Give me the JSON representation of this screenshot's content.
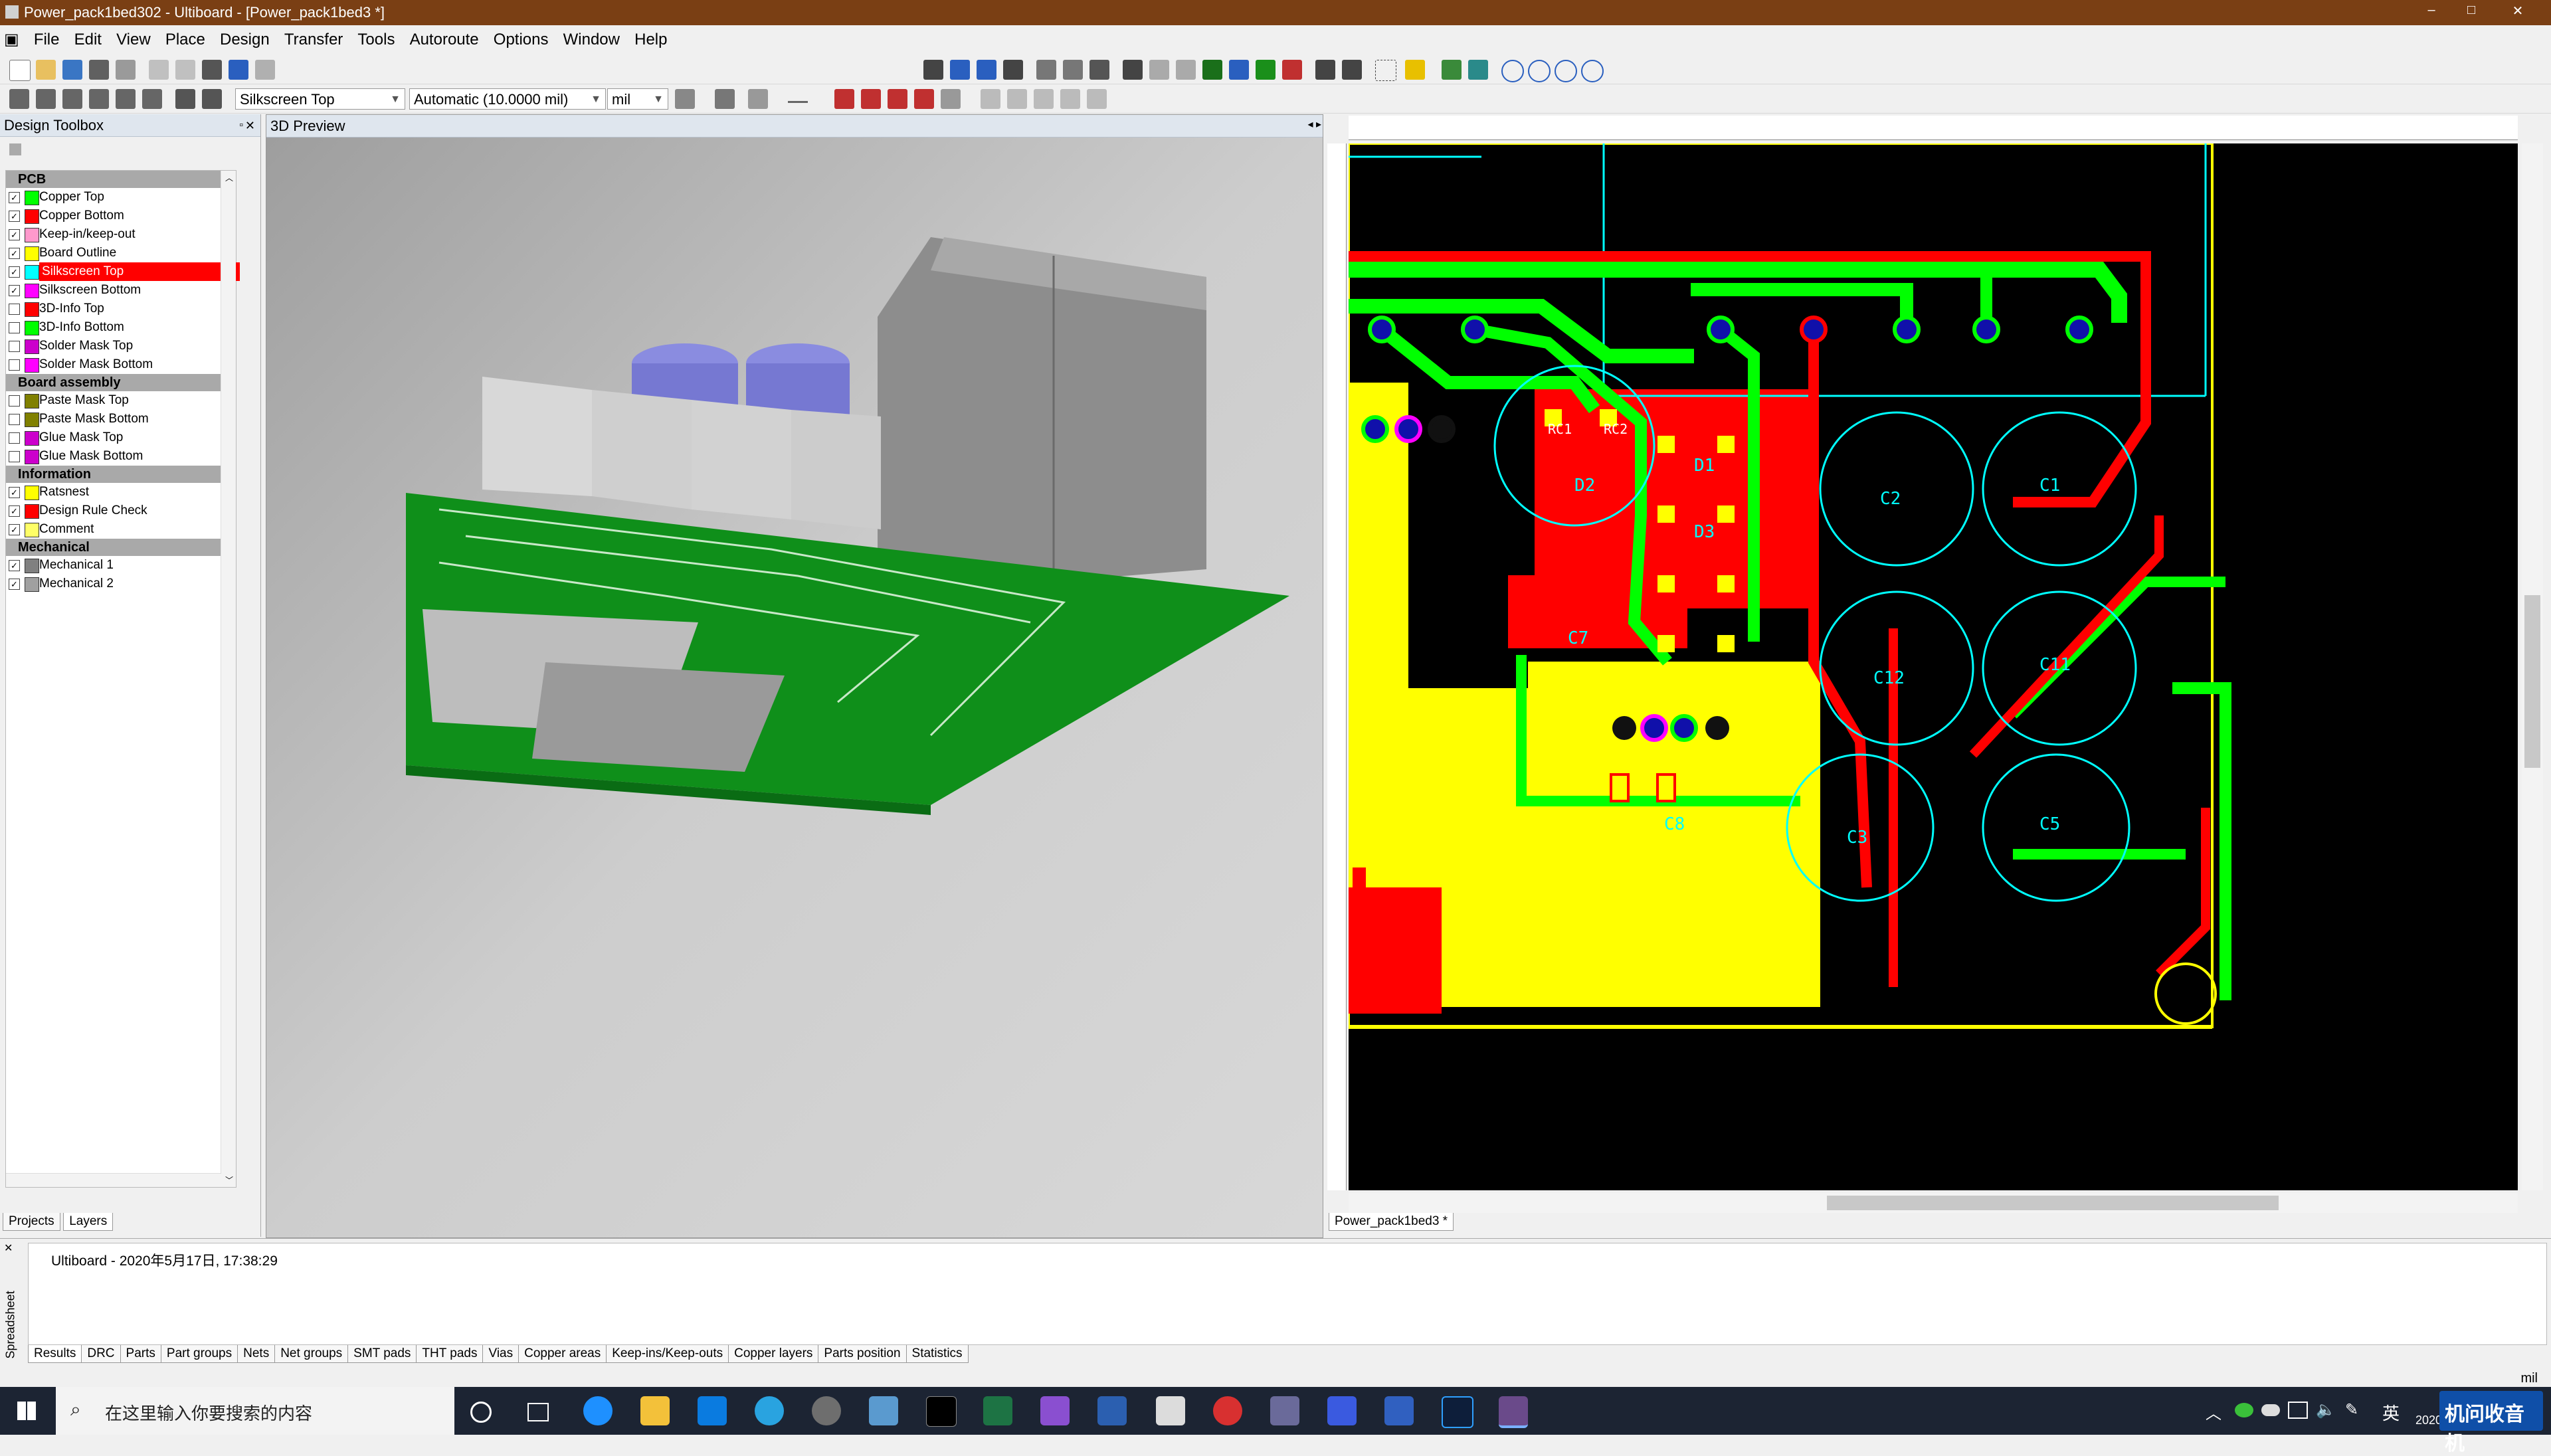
{
  "window": {
    "title": "Power_pack1bed302 - Ultiboard - [Power_pack1bed3 *]",
    "buttons": [
      "–",
      "□",
      "✕"
    ]
  },
  "menu": [
    "File",
    "Edit",
    "View",
    "Place",
    "Design",
    "Transfer",
    "Tools",
    "Autoroute",
    "Options",
    "Window",
    "Help"
  ],
  "toolbar": {
    "layer_select": "Silkscreen Top",
    "width_select": "Automatic (10.0000 mil)",
    "unit_select": "mil"
  },
  "design_toolbox": {
    "title": "Design Toolbox",
    "groups": [
      {
        "name": "PCB",
        "layers": [
          {
            "name": "Copper Top",
            "color": "#00ff00",
            "checked": true
          },
          {
            "name": "Copper Bottom",
            "color": "#ff0000",
            "checked": true
          },
          {
            "name": "Keep-in/keep-out",
            "color": "#ff99cc",
            "checked": true
          },
          {
            "name": "Board Outline",
            "color": "#ffff00",
            "checked": true
          },
          {
            "name": "Silkscreen Top",
            "color": "#00ffff",
            "checked": true,
            "selected": true
          },
          {
            "name": "Silkscreen Bottom",
            "color": "#ff00ff",
            "checked": true
          },
          {
            "name": "3D-Info Top",
            "color": "#ff0000",
            "checked": false
          },
          {
            "name": "3D-Info Bottom",
            "color": "#00ff00",
            "checked": false
          },
          {
            "name": "Solder Mask Top",
            "color": "#cc00cc",
            "checked": false
          },
          {
            "name": "Solder Mask Bottom",
            "color": "#ff00ff",
            "checked": false
          }
        ]
      },
      {
        "name": "Board assembly",
        "layers": [
          {
            "name": "Paste Mask Top",
            "color": "#808000",
            "checked": false
          },
          {
            "name": "Paste Mask Bottom",
            "color": "#808000",
            "checked": false
          },
          {
            "name": "Glue Mask Top",
            "color": "#cc00cc",
            "checked": false
          },
          {
            "name": "Glue Mask Bottom",
            "color": "#cc00cc",
            "checked": false
          }
        ]
      },
      {
        "name": "Information",
        "layers": [
          {
            "name": "Ratsnest",
            "color": "#ffff00",
            "checked": true
          },
          {
            "name": "Design Rule Check",
            "color": "#ff0000",
            "checked": true
          },
          {
            "name": "Comment",
            "color": "#ffff66",
            "checked": true
          }
        ]
      },
      {
        "name": "Mechanical",
        "layers": [
          {
            "name": "Mechanical 1",
            "color": "#808080",
            "checked": true
          },
          {
            "name": "Mechanical 2",
            "color": "#a0a0a0",
            "checked": true
          }
        ]
      }
    ],
    "tabs": [
      "Projects",
      "Layers"
    ]
  },
  "preview": {
    "title": "3D Preview"
  },
  "pcb_view": {
    "tab": "Power_pack1bed3 *",
    "labels": [
      "RC1",
      "RC2",
      "D2",
      "D1",
      "D3",
      "C7",
      "C2",
      "C1",
      "C11",
      "C12",
      "C3",
      "C5",
      "C8"
    ]
  },
  "output": {
    "side_label": "Spreadsheet",
    "message": "Ultiboard  -  2020年5月17日, 17:38:29",
    "tabs": [
      "Results",
      "DRC",
      "Parts",
      "Part groups",
      "Nets",
      "Net groups",
      "SMT pads",
      "THT pads",
      "Vias",
      "Copper areas",
      "Keep-ins/Keep-outs",
      "Copper layers",
      "Parts position",
      "Statistics"
    ]
  },
  "statusbar": {
    "unit": "mil"
  },
  "taskbar": {
    "search_placeholder": "在这里输入你要搜索的内容",
    "ime": "英",
    "watermark": "机问收音机",
    "date_partial": "2020"
  }
}
